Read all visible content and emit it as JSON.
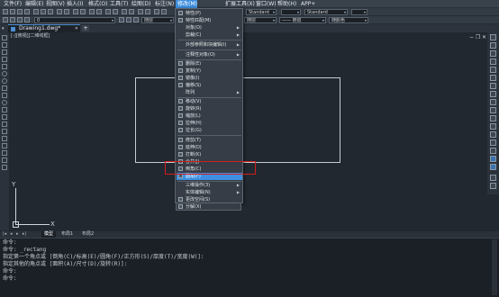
{
  "menubar": {
    "items": [
      "文件(F)",
      "编辑(E)",
      "视图(V)",
      "插入(I)",
      "格式(O)",
      "工具(T)",
      "绘图(D)",
      "标注(N)",
      "修改(M)",
      "扩展工具(X)",
      "窗口(W)",
      "帮助(H)",
      "APP+"
    ],
    "active": "修改(M)"
  },
  "toolbar": {
    "layer_combo": "0",
    "linetype_combo": "随层",
    "lineweight_combo": "—— 随层",
    "color_combo": "随颜色",
    "textstyle_combo": "Standard",
    "dimstyle_combo": "Standard"
  },
  "toolbar2": {
    "layer_combo": "0",
    "linetype_combo": "随层",
    "lineweight_combo": "—— 随层",
    "color_combo": "随颜色"
  },
  "tabs": {
    "document": "Drawing1.dwg*",
    "new_tab": "+"
  },
  "canvas": {
    "view_label": "[-][俯视][二维线框]",
    "ucs_x": "X",
    "ucs_y": "Y"
  },
  "window_controls": {
    "minimize": "−",
    "restore": "❐",
    "close": "✕"
  },
  "layout_tabs": [
    "模型",
    "布局1",
    "布局2"
  ],
  "layout_nav": [
    "|◂",
    "◂",
    "▸",
    "▸|"
  ],
  "dropdown": {
    "items": [
      {
        "label": "特性(P)",
        "submenu": false
      },
      {
        "label": "特性匹配(M)",
        "submenu": false
      },
      {
        "label": "对象(O)",
        "submenu": true
      },
      {
        "label": "剪裁(C)",
        "submenu": true
      },
      {
        "label": "外部参照和块编辑(I)",
        "submenu": true
      },
      {
        "label": "注释性对象(O)",
        "submenu": true
      },
      {
        "label": "删除(E)",
        "submenu": false
      },
      {
        "label": "复制(Y)",
        "submenu": false
      },
      {
        "label": "镜像(I)",
        "submenu": false
      },
      {
        "label": "偏移(S)",
        "submenu": false
      },
      {
        "label": "阵列",
        "submenu": true
      },
      {
        "label": "移动(V)",
        "submenu": false
      },
      {
        "label": "旋转(R)",
        "submenu": false
      },
      {
        "label": "缩放(L)",
        "submenu": false
      },
      {
        "label": "拉伸(H)",
        "submenu": false
      },
      {
        "label": "拉长(G)",
        "submenu": false
      },
      {
        "label": "修剪(T)",
        "submenu": false
      },
      {
        "label": "延伸(D)",
        "submenu": false
      },
      {
        "label": "打断(K)",
        "submenu": false
      },
      {
        "label": "合并(J)",
        "submenu": false
      },
      {
        "label": "倒角(C)",
        "submenu": false
      },
      {
        "label": "圆角(F)",
        "submenu": false
      },
      {
        "label": "三维操作(3)",
        "submenu": true
      },
      {
        "label": "实体编辑(N)",
        "submenu": true
      },
      {
        "label": "更改空间(S)",
        "submenu": false
      },
      {
        "label": "分解(X)",
        "submenu": false
      }
    ],
    "highlighted": "圆角(F)"
  },
  "command": {
    "lines": [
      "命令:",
      "命令: _rectang",
      "指定第一个角点或 [倒角(C)/标高(E)/圆角(F)/正方形(S)/厚度(T)/宽度(W)]:",
      "指定其他的角点或 [面积(A)/尺寸(D)/旋转(R)]:",
      "命令:",
      "命令:"
    ]
  },
  "colors": {
    "accent": "#3f8fe0",
    "highlight_box": "#d01e1e",
    "canvas_bg": "#212830"
  }
}
